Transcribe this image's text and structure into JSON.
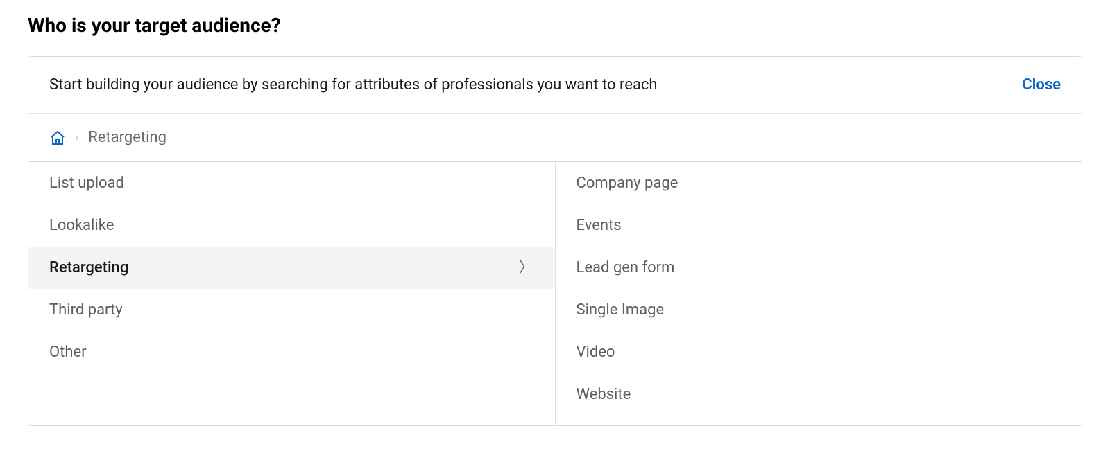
{
  "heading": "Who is your target audience?",
  "panel": {
    "header_text": "Start building your audience by searching for attributes of professionals you want to reach",
    "close_label": "Close"
  },
  "breadcrumb": {
    "current": "Retargeting"
  },
  "left_menu": [
    {
      "label": "List upload",
      "active": false
    },
    {
      "label": "Lookalike",
      "active": false
    },
    {
      "label": "Retargeting",
      "active": true
    },
    {
      "label": "Third party",
      "active": false
    },
    {
      "label": "Other",
      "active": false
    }
  ],
  "right_menu": [
    {
      "label": "Company page"
    },
    {
      "label": "Events"
    },
    {
      "label": "Lead gen form"
    },
    {
      "label": "Single Image"
    },
    {
      "label": "Video"
    },
    {
      "label": "Website"
    }
  ]
}
